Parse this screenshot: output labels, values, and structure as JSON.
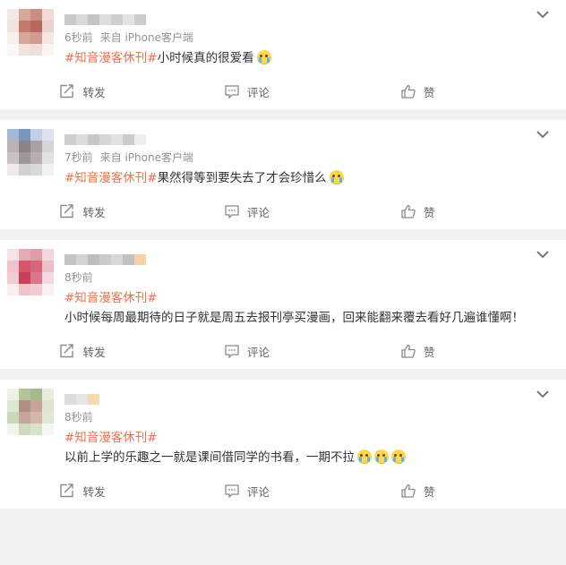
{
  "posts": [
    {
      "time": "6秒前",
      "source": "来自 iPhone客户端",
      "tag": "#知音漫客休刊#",
      "content": "小时候真的很爱看",
      "emoji_count": 1,
      "avatar_colors": [
        "#f3e8e6",
        "#d9a69c",
        "#c98d83",
        "#f0dcd8",
        "#f2e3e0",
        "#c37a6d",
        "#b56a5e",
        "#ecd3cd",
        "#f7efed",
        "#d8a79c",
        "#cf9a8f",
        "#f3e6e3",
        "#fbf7f6",
        "#f1e2de",
        "#efdfdb",
        "#faf4f3"
      ],
      "name_colors": [
        "#c9c9c9",
        "#d9d9d9",
        "#c4c4c4",
        "#dedede",
        "#cfcfcf",
        "#e3e3e3",
        "#cccccc"
      ]
    },
    {
      "time": "7秒前",
      "source": "来自 iPhone客户端",
      "tag": "#知音漫客休刊#",
      "content": "果然得等到要失去了才会珍惜么",
      "emoji_count": 1,
      "avatar_colors": [
        "#a4b8d6",
        "#7c95bd",
        "#c3cfe2",
        "#dde3ee",
        "#b9b3b5",
        "#8a8489",
        "#a8a0a6",
        "#d7d3d6",
        "#c9c3c6",
        "#9f979d",
        "#b6aeb3",
        "#e5e1e3",
        "#eeeaec",
        "#d4cfd2",
        "#dcd7da",
        "#f3f1f2"
      ],
      "name_colors": [
        "#cfcfcf",
        "#dcdcdc",
        "#c7c7c7",
        "#d6d6d6",
        "#e2e2e2",
        "#cbcbcb",
        "#eeeeee"
      ]
    },
    {
      "time": "8秒前",
      "source": "",
      "tag": "#知音漫客休刊#",
      "content": "小时候每周最期待的日子就是周五去报刊亭买漫画，回来能翻来覆去看好几遍谁懂啊！",
      "emoji_count": 0,
      "avatar_colors": [
        "#f6e3e6",
        "#e7a9b4",
        "#e29aa8",
        "#f3d7dc",
        "#efc3cb",
        "#d6566b",
        "#d8667a",
        "#edc0c8",
        "#f1cbd2",
        "#c94059",
        "#d9768a",
        "#f4d9de",
        "#faeef0",
        "#eec3cb",
        "#f0cbd2",
        "#fbf1f3"
      ],
      "name_colors": [
        "#c4c4c4",
        "#d3d3d3",
        "#bdbdbd",
        "#cacaca",
        "#d8d8d8",
        "#c1c1c1",
        "#f5d2a8"
      ]
    },
    {
      "time": "8秒前",
      "source": "",
      "tag": "#知音漫客休刊#",
      "content": "以前上学的乐趣之一就是课间借同学的书看，一期不拉",
      "emoji_count": 3,
      "avatar_colors": [
        "#eef2e6",
        "#b3c49a",
        "#a6b98b",
        "#e6ecdc",
        "#dfe7d2",
        "#b08f88",
        "#c9a39b",
        "#dde5cf",
        "#cbd8b8",
        "#c5a59e",
        "#d4b6ae",
        "#dfe8d1",
        "#f2f5ec",
        "#cfdabf",
        "#d9e2cb",
        "#f5f8f0"
      ],
      "name_colors": [
        "#dcdcdc",
        "#e6e6e6",
        "#f5d9b0"
      ]
    }
  ],
  "actions": {
    "repost": "转发",
    "comment": "评论",
    "like": "赞"
  },
  "colors": {
    "topic": "#eb7350",
    "meta": "#939393",
    "background": "#f2f2f5"
  }
}
